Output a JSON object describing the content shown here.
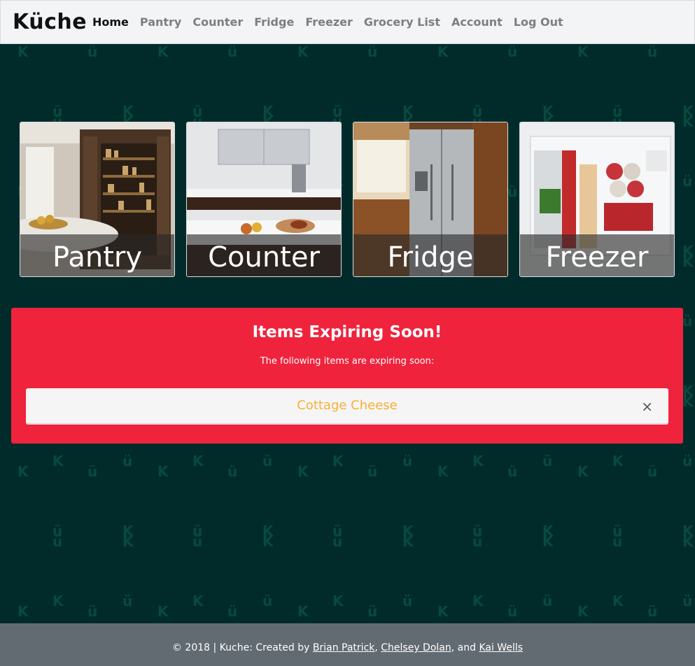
{
  "brand": "Küche",
  "nav": {
    "items": [
      {
        "label": "Home",
        "active": true
      },
      {
        "label": "Pantry"
      },
      {
        "label": "Counter"
      },
      {
        "label": "Fridge"
      },
      {
        "label": "Freezer"
      },
      {
        "label": "Grocery List"
      },
      {
        "label": "Account"
      },
      {
        "label": "Log Out"
      }
    ]
  },
  "cards": [
    {
      "label": "Pantry"
    },
    {
      "label": "Counter"
    },
    {
      "label": "Fridge"
    },
    {
      "label": "Freezer"
    }
  ],
  "alert": {
    "title": "Items Expiring Soon!",
    "subtitle": "The following items are expiring soon:",
    "items": [
      {
        "name": "Cottage Cheese",
        "close_glyph": "×"
      }
    ]
  },
  "footer": {
    "prefix": "© 2018 | Kuche: Created by ",
    "authors": [
      "Brian Patrick",
      "Chelsey Dolan",
      "Kai Wells"
    ],
    "sep1": ", ",
    "sep2": ", and "
  },
  "colors": {
    "background": "#012b2b",
    "alert": "#ef233c",
    "item_text": "#f7b035",
    "footer": "#626b72"
  }
}
